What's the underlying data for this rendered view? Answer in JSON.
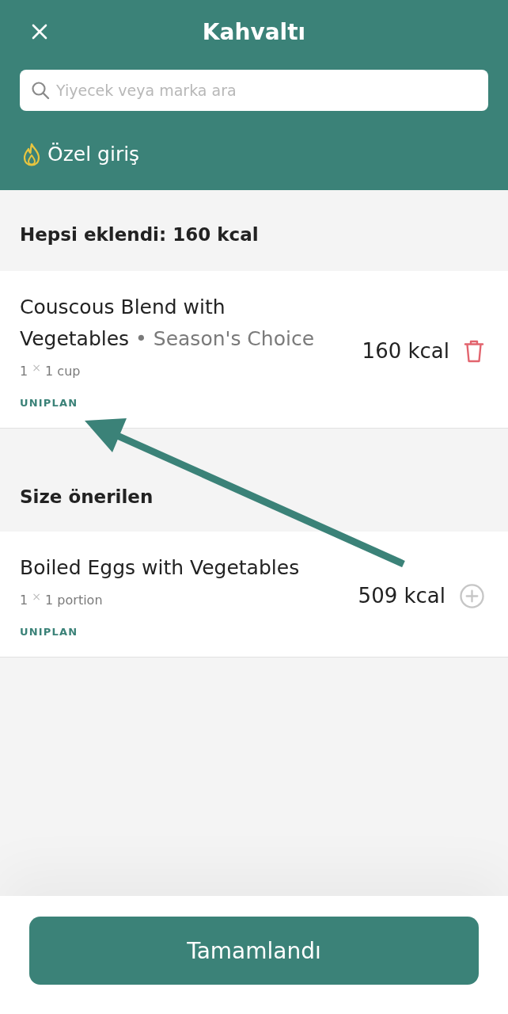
{
  "header": {
    "title": "Kahvaltı",
    "search": {
      "placeholder": "Yiyecek veya marka ara"
    },
    "custom_entry": "Özel giriş"
  },
  "sections": [
    {
      "title": "Hepsi eklendi: 160 kcal",
      "items": [
        {
          "name": "Couscous Blend with Vegetables",
          "brand_separator": "•",
          "brand": "Season's Choice",
          "serving": "1 $^{×}$ 1 cup",
          "tag": "UNIPLAN",
          "calories": "160 kcal",
          "kind": "remove"
        }
      ]
    },
    {
      "title": "Size önerilen",
      "items": [
        {
          "name": "Boiled Eggs with Vegetables",
          "serving": "1 $^{×}$ 1 portion",
          "tag": "UNIPLAN",
          "calories": "509 kcal",
          "kind": "add"
        }
      ]
    }
  ],
  "done_button": "Tamamlandı"
}
